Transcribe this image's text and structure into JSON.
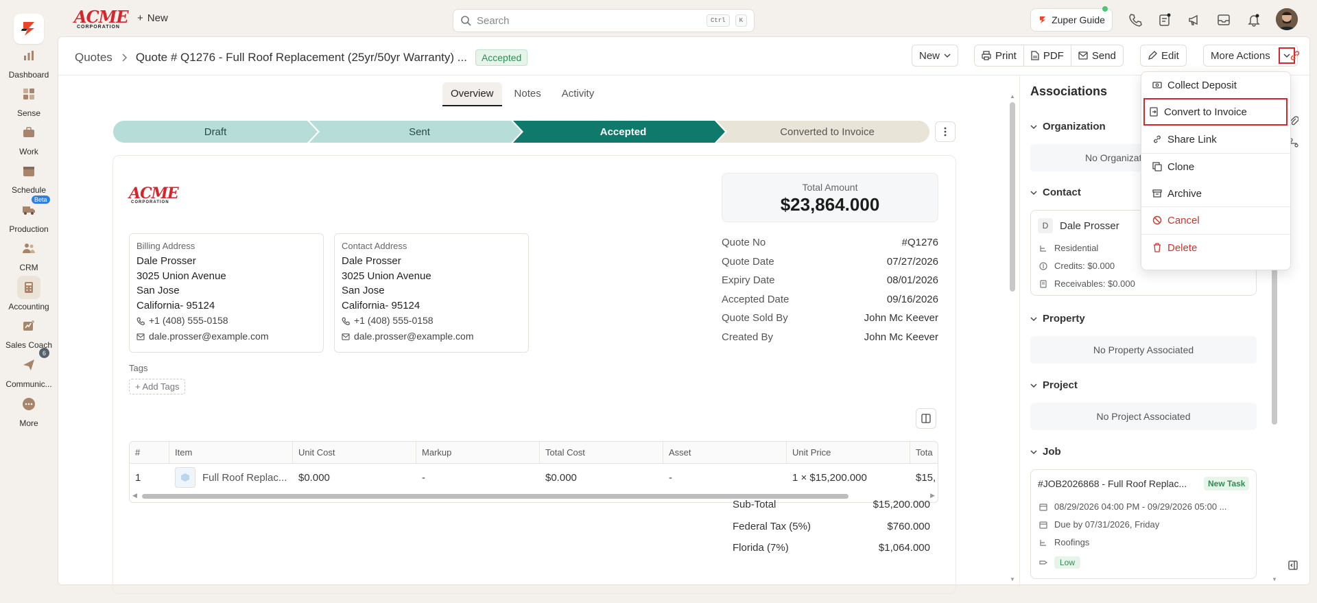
{
  "nav": {
    "items": [
      {
        "label": "Dashboard"
      },
      {
        "label": "Sense"
      },
      {
        "label": "Work"
      },
      {
        "label": "Schedule"
      },
      {
        "label": "Production",
        "badge": "Beta"
      },
      {
        "label": "CRM"
      },
      {
        "label": "Accounting",
        "active": true
      },
      {
        "label": "Sales Coach"
      },
      {
        "label": "Communic...",
        "badge": "6"
      },
      {
        "label": "More"
      }
    ]
  },
  "topbar": {
    "brand": "ACME",
    "brand_sub": "CORPORATION",
    "new_label": "New",
    "search_placeholder": "Search",
    "kbd_ctrl": "Ctrl",
    "kbd_k": "K",
    "guide_label": "Zuper Guide"
  },
  "header": {
    "breadcrumb_root": "Quotes",
    "quote_title": "Quote # Q1276 - Full Roof Replacement (25yr/50yr Warranty) ...",
    "status": "Accepted",
    "new_label": "New",
    "print_label": "Print",
    "pdf_label": "PDF",
    "send_label": "Send",
    "edit_label": "Edit",
    "more_actions_label": "More Actions"
  },
  "tabs": [
    {
      "label": "Overview",
      "active": true
    },
    {
      "label": "Notes"
    },
    {
      "label": "Activity"
    }
  ],
  "stepper": [
    "Draft",
    "Sent",
    "Accepted",
    "Converted to Invoice"
  ],
  "quote": {
    "total_label": "Total Amount",
    "total_value": "$23,864.000",
    "billing": {
      "title": "Billing Address",
      "name": "Dale Prosser",
      "street": "3025 Union Avenue",
      "city": "San Jose",
      "state_zip": "California- 95124",
      "phone": "+1 (408) 555-0158",
      "email": "dale.prosser@example.com"
    },
    "contact": {
      "title": "Contact Address",
      "name": "Dale Prosser",
      "street": "3025 Union Avenue",
      "city": "San Jose",
      "state_zip": "California- 95124",
      "phone": "+1 (408) 555-0158",
      "email": "dale.prosser@example.com"
    },
    "meta": [
      {
        "k": "Quote No",
        "v": "#Q1276"
      },
      {
        "k": "Quote Date",
        "v": "07/27/2026"
      },
      {
        "k": "Expiry Date",
        "v": "08/01/2026"
      },
      {
        "k": "Accepted Date",
        "v": "09/16/2026"
      },
      {
        "k": "Quote Sold By",
        "v": "John Mc Keever"
      },
      {
        "k": "Created By",
        "v": "John Mc Keever"
      }
    ],
    "tags_label": "Tags",
    "add_tags_label": "+ Add Tags",
    "table": {
      "headers": [
        "#",
        "Item",
        "Unit Cost",
        "Markup",
        "Total Cost",
        "Asset",
        "Unit Price",
        "Tota"
      ],
      "row": [
        "1",
        "Full Roof Replac...",
        "$0.000",
        "-",
        "$0.000",
        "-",
        "1 × $15,200.000",
        "$15,"
      ]
    },
    "sums": [
      {
        "k": "Sub-Total",
        "v": "$15,200.000"
      },
      {
        "k": "Federal Tax (5%)",
        "v": "$760.000"
      },
      {
        "k": "Florida (7%)",
        "v": "$1,064.000"
      }
    ]
  },
  "associations": {
    "title": "Associations",
    "organization_label": "Organization",
    "organization_empty": "No Organizat",
    "contact_label": "Contact",
    "contact_initial": "D",
    "contact_name": "Dale Prosser",
    "contact_type": "Residential",
    "credits": "Credits: $0.000",
    "receivables": "Receivables: $0.000",
    "property_label": "Property",
    "property_empty": "No Property Associated",
    "project_label": "Project",
    "project_empty": "No Project Associated",
    "job_label": "Job",
    "job_title": "#JOB2026868 - Full Roof Replac...",
    "job_status": "New Task",
    "job_schedule": "08/29/2026 04:00 PM - 09/29/2026 05:00 ...",
    "job_due": "Due by 07/31/2026, Friday",
    "job_category": "Roofings",
    "job_priority": "Low"
  },
  "menu": {
    "items": [
      {
        "label": "Collect Deposit"
      },
      {
        "label": "Convert to Invoice",
        "highlighted": true
      },
      {
        "label": "Share Link"
      },
      {
        "label": "Clone"
      },
      {
        "label": "Archive"
      },
      {
        "label": "Cancel",
        "danger": true
      },
      {
        "label": "Delete",
        "danger": true
      }
    ]
  },
  "colors": {
    "accent": "#0f7a6c",
    "step_done": "#b6ddd8",
    "step_pending": "#e9e4d8",
    "danger": "#d0342c",
    "highlight_box": "#d7262b"
  }
}
